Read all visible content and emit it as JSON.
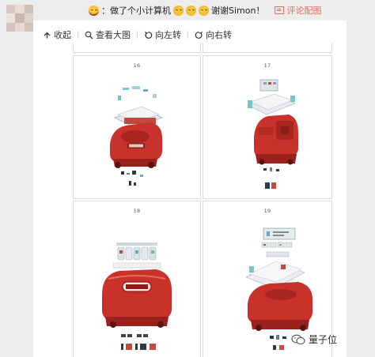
{
  "header": {
    "prefix": "：做了个小计算机",
    "suffix": "谢谢Simon！",
    "comment_label": "评论配图"
  },
  "toolbar": {
    "collapse_label": "收起",
    "view_large_label": "查看大图",
    "rotate_left_label": "向左转",
    "rotate_right_label": "向右转"
  },
  "images": [
    {
      "number": "16"
    },
    {
      "number": "17"
    },
    {
      "number": "18"
    },
    {
      "number": "19"
    }
  ],
  "watermark": {
    "label": "量子位"
  },
  "colors": {
    "accent": "#e06c5c",
    "robot_red": "#c8322a",
    "page_bg": "#ededed"
  }
}
